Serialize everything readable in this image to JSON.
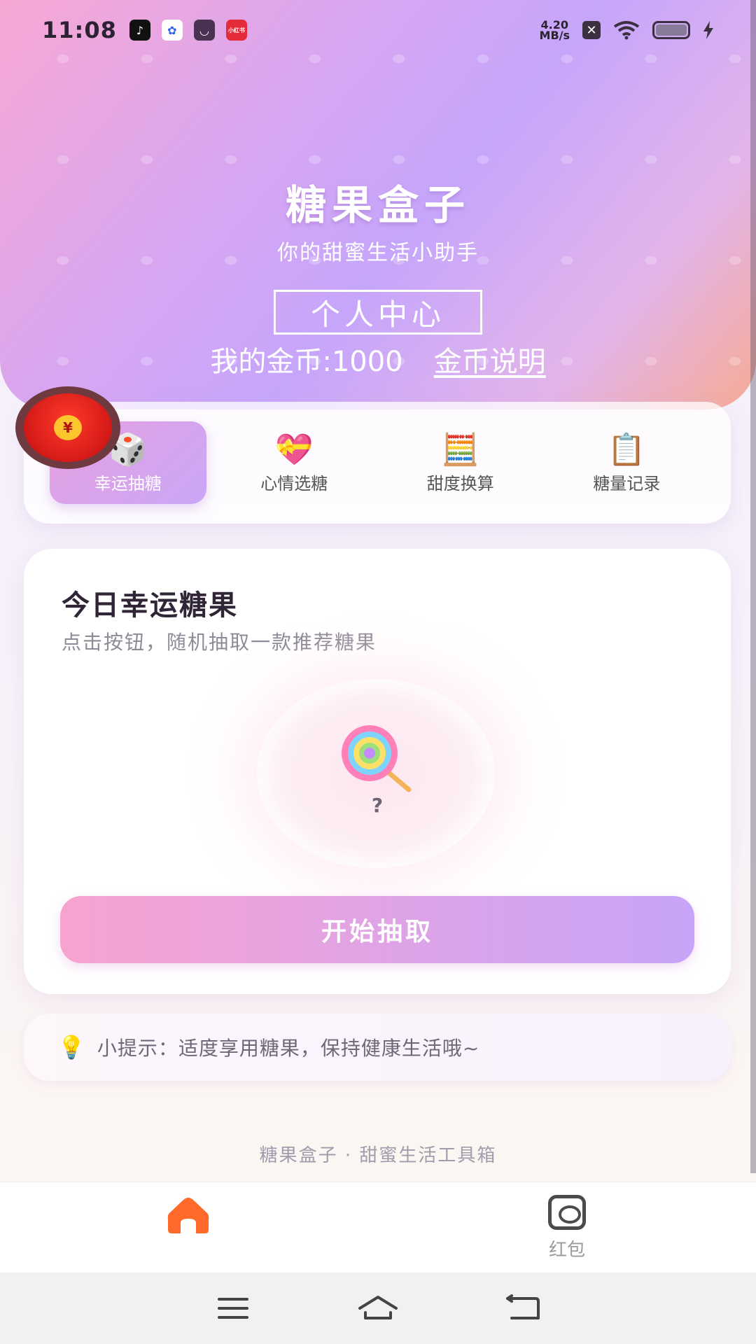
{
  "status_bar": {
    "time": "11:08",
    "net_speed_value": "4.20",
    "net_speed_unit": "MB/s",
    "apps": [
      "tiktok-icon",
      "baidu-icon",
      "mail-icon",
      "xiaohongshu-icon"
    ],
    "xiaohongshu_label": "小红书"
  },
  "hero": {
    "title": "糖果盒子",
    "subtitle": "你的甜蜜生活小助手",
    "center_button": "个人中心",
    "coins_label": "我的金币:1000",
    "coins_link": "金币说明"
  },
  "tabs": [
    {
      "label": "幸运抽糖",
      "emoji": "🎲",
      "active": true
    },
    {
      "label": "心情选糖",
      "emoji": "💝",
      "active": false
    },
    {
      "label": "甜度换算",
      "emoji": "🧮",
      "active": false
    },
    {
      "label": "糖量记录",
      "emoji": "📋",
      "active": false
    }
  ],
  "redpacket_coin": "¥",
  "main": {
    "title": "今日幸运糖果",
    "subtitle": "点击按钮，随机抽取一款推荐糖果",
    "result": "?",
    "draw_button": "开始抽取"
  },
  "tip": {
    "icon": "💡",
    "text": "小提示：适度享用糖果，保持健康生活哦~"
  },
  "footer": "糖果盒子 · 甜蜜生活工具箱",
  "bottom_nav": {
    "home_icon": "home-icon",
    "redpacket_label": "红包"
  },
  "colors": {
    "accent_pink": "#f7a3cf",
    "accent_purple": "#c6a4f7",
    "home_orange": "#ff6a2b"
  }
}
